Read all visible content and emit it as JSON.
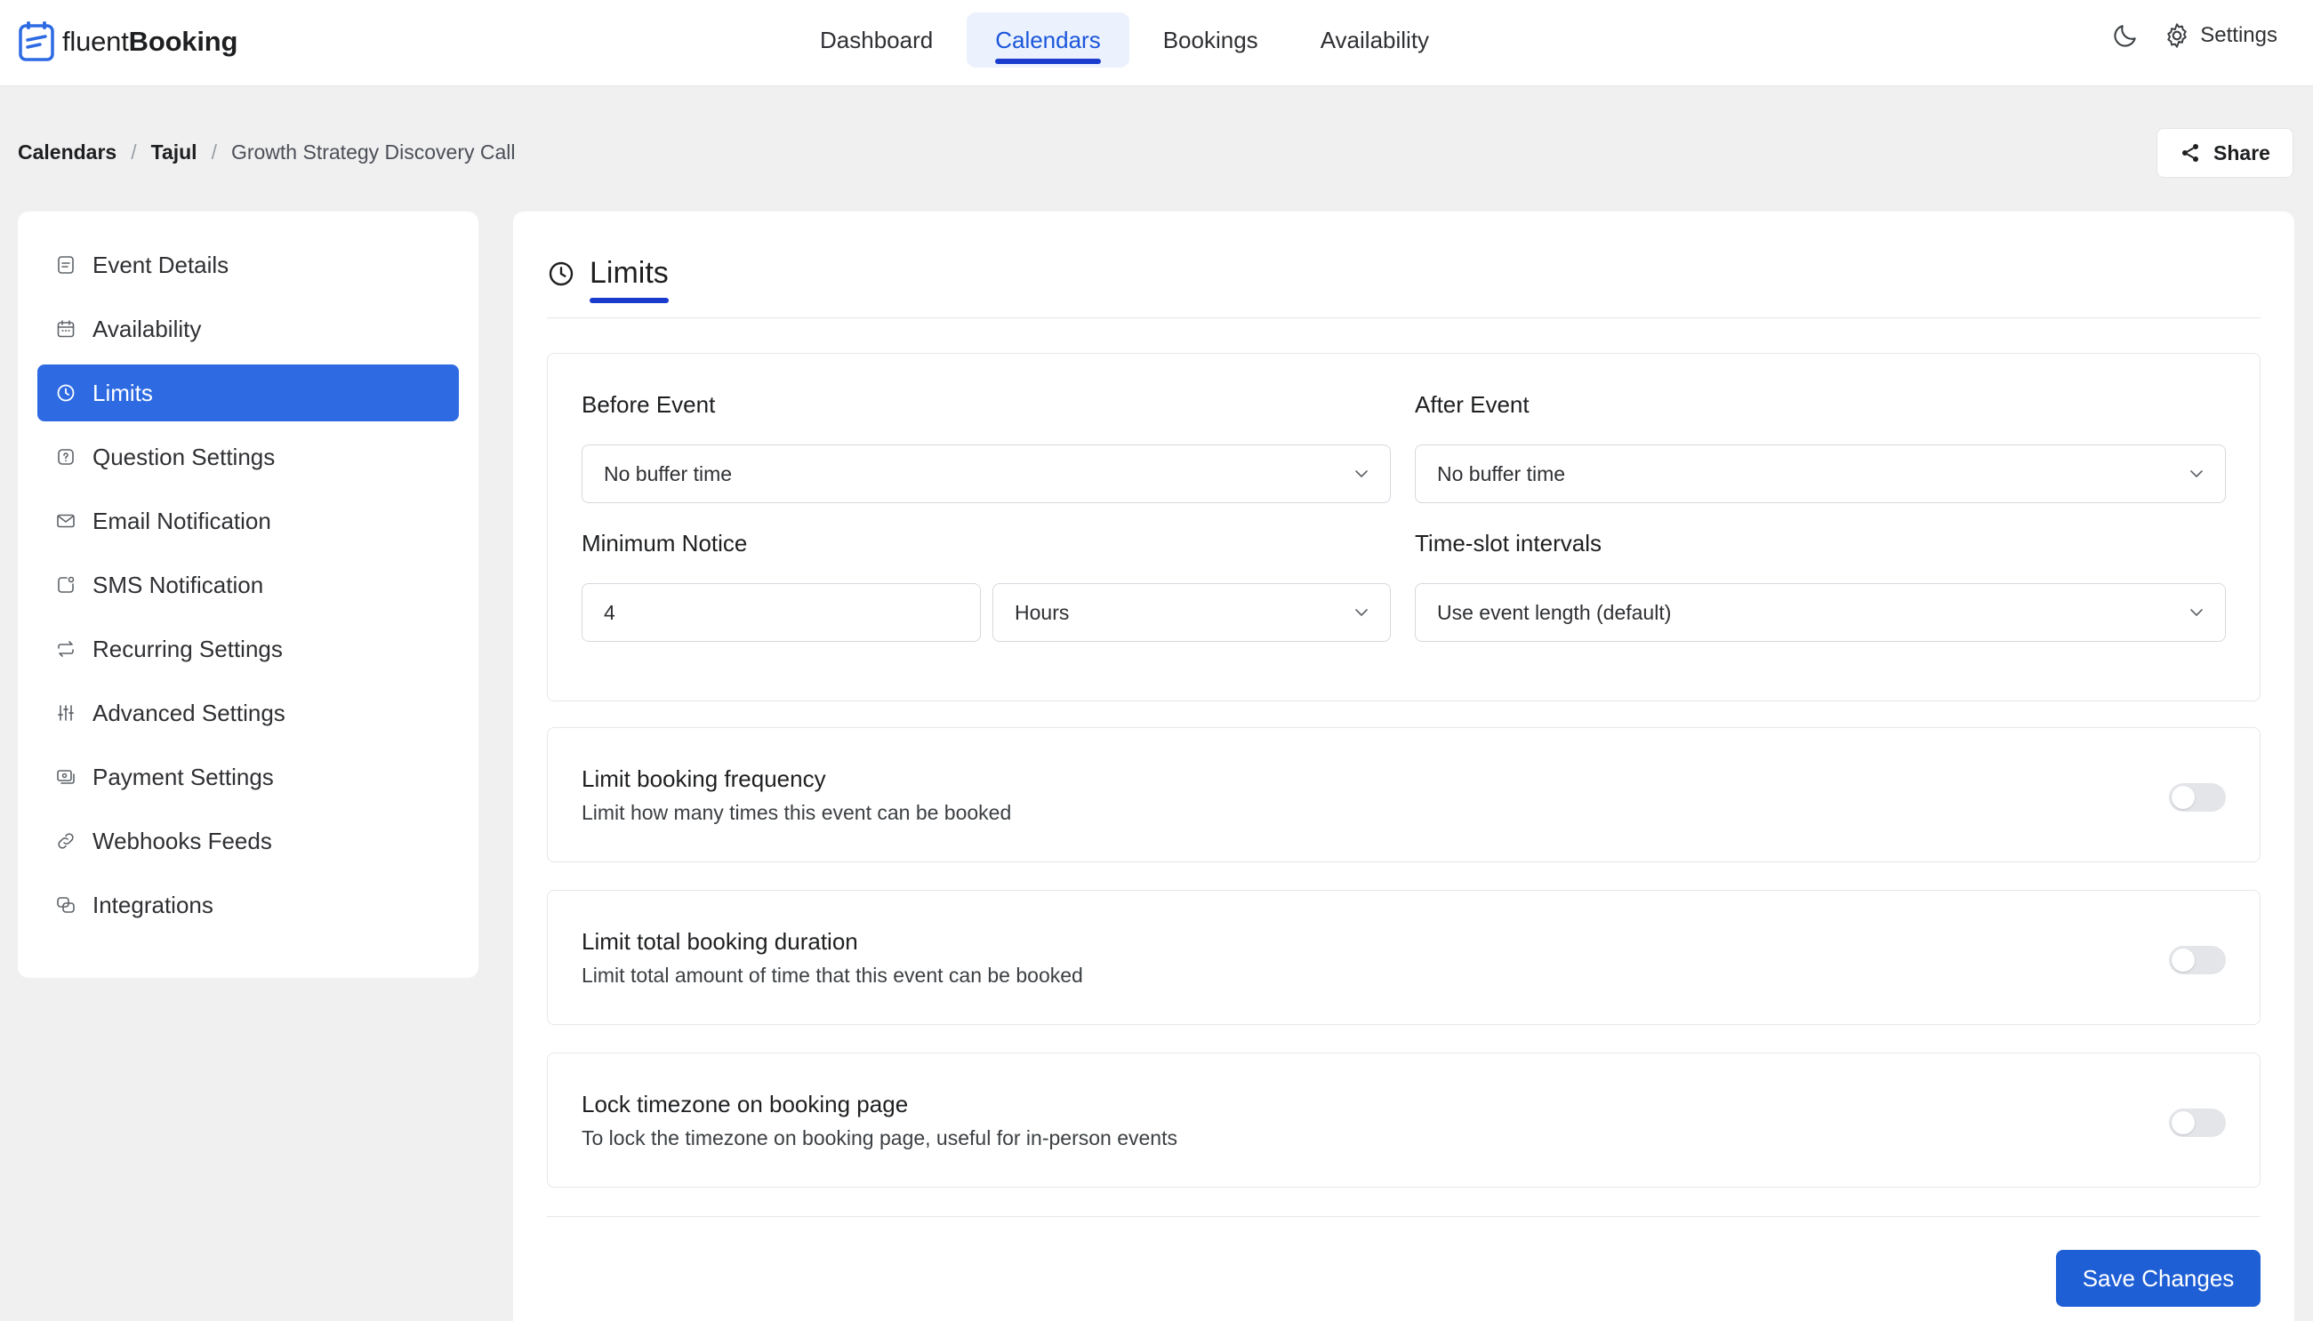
{
  "app": {
    "logo_light": "fluent",
    "logo_bold": "Booking"
  },
  "nav": {
    "items": [
      {
        "label": "Dashboard"
      },
      {
        "label": "Calendars",
        "active": true
      },
      {
        "label": "Bookings"
      },
      {
        "label": "Availability"
      }
    ],
    "settings_label": "Settings"
  },
  "breadcrumb": {
    "items": [
      "Calendars",
      "Tajul",
      "Growth Strategy Discovery Call"
    ],
    "separator": "/"
  },
  "share_label": "Share",
  "sidebar": {
    "items": [
      {
        "label": "Event Details",
        "icon": "document-icon"
      },
      {
        "label": "Availability",
        "icon": "calendar-icon"
      },
      {
        "label": "Limits",
        "icon": "clock-icon",
        "active": true
      },
      {
        "label": "Question Settings",
        "icon": "question-icon"
      },
      {
        "label": "Email Notification",
        "icon": "mail-icon"
      },
      {
        "label": "SMS Notification",
        "icon": "sms-icon"
      },
      {
        "label": "Recurring Settings",
        "icon": "repeat-icon"
      },
      {
        "label": "Advanced Settings",
        "icon": "sliders-icon"
      },
      {
        "label": "Payment Settings",
        "icon": "payment-icon"
      },
      {
        "label": "Webhooks Feeds",
        "icon": "link-icon"
      },
      {
        "label": "Integrations",
        "icon": "integrations-icon"
      }
    ]
  },
  "main": {
    "title": "Limits",
    "before_event": {
      "label": "Before Event",
      "value": "No buffer time"
    },
    "after_event": {
      "label": "After Event",
      "value": "No buffer time"
    },
    "minimum_notice": {
      "label": "Minimum Notice",
      "value": "4",
      "unit": "Hours"
    },
    "time_slot": {
      "label": "Time-slot intervals",
      "value": "Use event length (default)"
    },
    "toggles": [
      {
        "title": "Limit booking frequency",
        "desc": "Limit how many times this event can be booked",
        "on": false
      },
      {
        "title": "Limit total booking duration",
        "desc": "Limit total amount of time that this event can be booked",
        "on": false
      },
      {
        "title": "Lock timezone on booking page",
        "desc": "To lock the timezone on booking page, useful for in-person events",
        "on": false
      }
    ],
    "save_label": "Save Changes"
  },
  "colors": {
    "accent": "#2e6be3",
    "nav_active_bg": "#ebf1fd",
    "underline": "#1a3ccd",
    "save_button": "#1f5fd6"
  }
}
